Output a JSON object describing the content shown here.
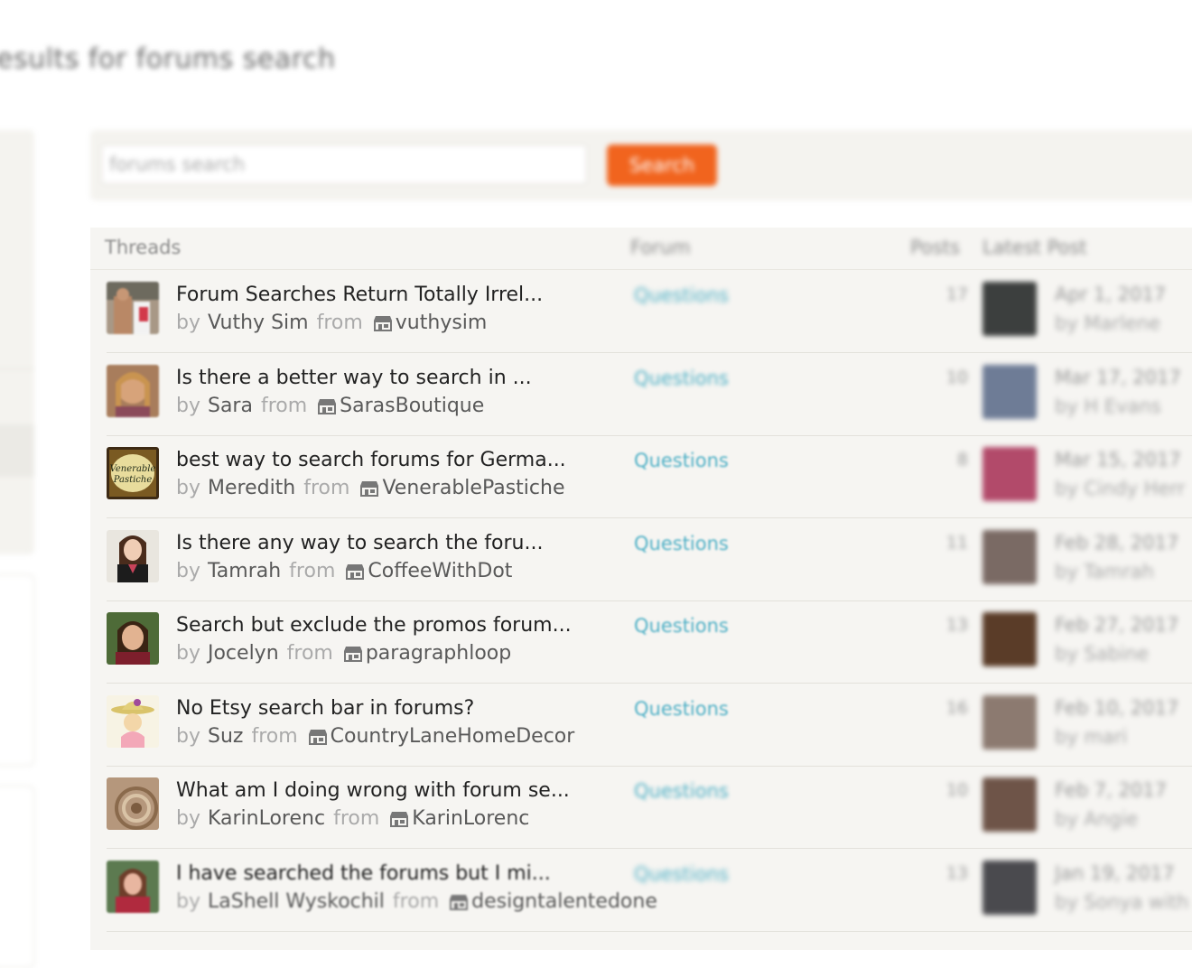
{
  "page": {
    "title": "esults for forums search"
  },
  "search": {
    "placeholder": "forums search",
    "button_label": "Search"
  },
  "table": {
    "headers": {
      "threads": "Threads",
      "forum": "Forum",
      "posts": "Posts",
      "latest": "Latest Post"
    },
    "rows": [
      {
        "title": "Forum Searches Return Totally Irrel...",
        "by": "by",
        "author": "Vuthy Sim",
        "from": "from",
        "shop": "vuthysim",
        "forum": "Questions",
        "posts": "17",
        "latest_date": "Apr 1, 2017",
        "latest_by": "by Marlene"
      },
      {
        "title": "Is there a better way to search in ...",
        "by": "by",
        "author": "Sara",
        "from": "from",
        "shop": "SarasBoutique",
        "forum": "Questions",
        "posts": "10",
        "latest_date": "Mar 17, 2017",
        "latest_by": "by H Evans"
      },
      {
        "title": "best way to search forums for Germa...",
        "by": "by",
        "author": "Meredith",
        "from": "from",
        "shop": "VenerablePastiche",
        "forum": "Questions",
        "posts": "8",
        "latest_date": "Mar 15, 2017",
        "latest_by": "by Cindy Herr"
      },
      {
        "title": "Is there any way to search the foru...",
        "by": "by",
        "author": "Tamrah",
        "from": "from",
        "shop": "CoffeeWithDot",
        "forum": "Questions",
        "posts": "11",
        "latest_date": "Feb 28, 2017",
        "latest_by": "by Tamrah"
      },
      {
        "title": "Search but exclude the promos forum...",
        "by": "by",
        "author": "Jocelyn",
        "from": "from",
        "shop": "paragraphloop",
        "forum": "Questions",
        "posts": "13",
        "latest_date": "Feb 27, 2017",
        "latest_by": "by Sabine"
      },
      {
        "title": "No Etsy search bar in forums?",
        "by": "by",
        "author": "Suz",
        "from": "from",
        "shop": "CountryLaneHomeDecor",
        "forum": "Questions",
        "posts": "16",
        "latest_date": "Feb 10, 2017",
        "latest_by": "by mari"
      },
      {
        "title": "What am I doing wrong with forum se...",
        "by": "by",
        "author": "KarinLorenc",
        "from": "from",
        "shop": "KarinLorenc",
        "forum": "Questions",
        "posts": "10",
        "latest_date": "Feb 7, 2017",
        "latest_by": "by Angie"
      },
      {
        "title": "I have searched the forums but I mi...",
        "by": "by",
        "author": "LaShell Wyskochil",
        "from": "from",
        "shop": "designtalentedone",
        "forum": "Questions",
        "posts": "13",
        "latest_date": "Jan 19, 2017",
        "latest_by": "by Sonya with"
      }
    ]
  },
  "avatar_logo_text": [
    "Venerable",
    "Pastiche"
  ],
  "colors": {
    "accent": "#f1641e",
    "link": "#4fb0c6",
    "panel": "#f4f3ef"
  },
  "icons": {
    "shop": "shop-icon"
  }
}
